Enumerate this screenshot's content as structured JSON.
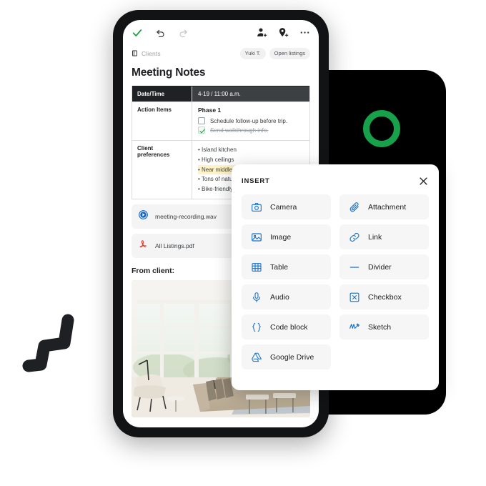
{
  "decor": {
    "green_ring_color": "#16a14a",
    "panel_color": "#000000",
    "zigzag_color": "#1f2023"
  },
  "phone": {
    "toolbar": {
      "done_label": "done-check",
      "undo_label": "undo",
      "redo_label": "redo",
      "add_person_label": "add-person",
      "add_tag_label": "add-location-tag",
      "more_label": "more-options"
    },
    "breadcrumb": {
      "icon": "document-icon",
      "label": "Clients"
    },
    "pills": [
      {
        "label": "Yuki T."
      },
      {
        "label": "Open listings"
      }
    ],
    "title": "Meeting Notes",
    "table": {
      "rows": [
        {
          "label": "Date/Time",
          "value": "4-19 / 11:00 a.m."
        },
        {
          "label": "Action Items",
          "phase": "Phase 1"
        },
        {
          "label": "Client preferences"
        }
      ],
      "checklist": [
        {
          "text": "Schedule follow-up before trip.",
          "done": false
        },
        {
          "text": "Send walkthrough info.",
          "done": true
        }
      ],
      "preferences": [
        {
          "text": "• Island kitchen",
          "highlight": false
        },
        {
          "text": "• High ceilings",
          "highlight": false
        },
        {
          "text": "• Near middle school",
          "highlight": true
        },
        {
          "text": "• Tons of natural light",
          "highlight": false
        },
        {
          "text": "• Bike-friendly area",
          "highlight": false
        }
      ]
    },
    "attachments": [
      {
        "name": "meeting-recording.wav",
        "icon": "play-circle-icon"
      },
      {
        "name": "All Listings.pdf",
        "icon": "pdf-icon"
      }
    ],
    "from_client_label": "From client:",
    "photo_alt": "living-room-interior-photo"
  },
  "insert_dialog": {
    "title": "INSERT",
    "close_label": "close-icon",
    "options": [
      {
        "label": "Camera",
        "icon": "camera-icon"
      },
      {
        "label": "Attachment",
        "icon": "paperclip-icon"
      },
      {
        "label": "Image",
        "icon": "image-icon"
      },
      {
        "label": "Link",
        "icon": "link-icon"
      },
      {
        "label": "Table",
        "icon": "table-icon"
      },
      {
        "label": "Divider",
        "icon": "divider-icon"
      },
      {
        "label": "Audio",
        "icon": "microphone-icon"
      },
      {
        "label": "Checkbox",
        "icon": "checkbox-icon"
      },
      {
        "label": "Code block",
        "icon": "code-braces-icon"
      },
      {
        "label": "Sketch",
        "icon": "sketch-icon"
      },
      {
        "label": "Google Drive",
        "icon": "google-drive-icon"
      }
    ],
    "accent_color": "#1a73c8"
  }
}
